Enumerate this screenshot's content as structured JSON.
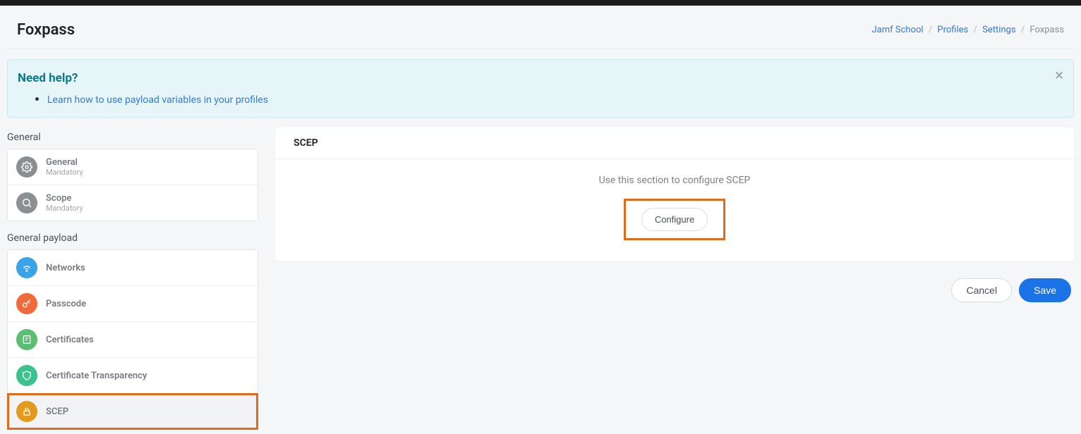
{
  "header": {
    "title": "Foxpass",
    "breadcrumb": [
      {
        "label": "Jamf School",
        "link": true
      },
      {
        "label": "Profiles",
        "link": true
      },
      {
        "label": "Settings",
        "link": true
      },
      {
        "label": "Foxpass",
        "link": false
      }
    ]
  },
  "alert": {
    "title": "Need help?",
    "link_text": "Learn how to use payload variables in your profiles"
  },
  "sidebar": {
    "section_general": "General",
    "general_items": [
      {
        "title": "General",
        "sub": "Mandatory"
      },
      {
        "title": "Scope",
        "sub": "Mandatory"
      }
    ],
    "section_payload": "General payload",
    "payload_items": [
      {
        "title": "Networks"
      },
      {
        "title": "Passcode"
      },
      {
        "title": "Certificates"
      },
      {
        "title": "Certificate Transparency"
      },
      {
        "title": "SCEP",
        "active": true,
        "highlight": true
      }
    ]
  },
  "main": {
    "panel_title": "SCEP",
    "panel_desc": "Use this section to configure SCEP",
    "configure_label": "Configure",
    "cancel_label": "Cancel",
    "save_label": "Save"
  }
}
